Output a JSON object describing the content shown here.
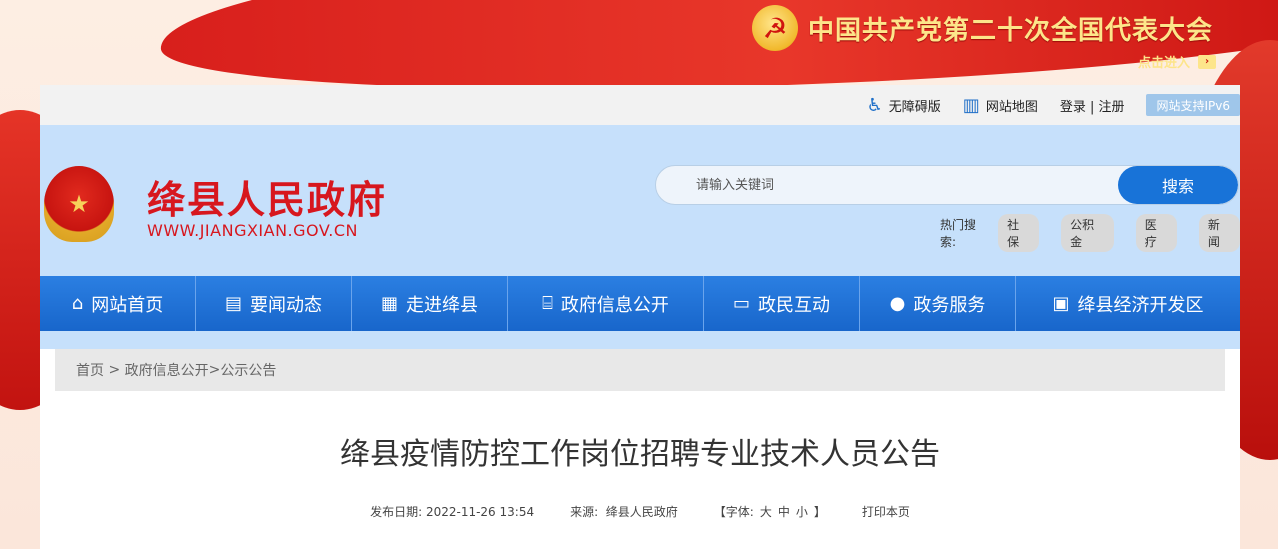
{
  "banner": {
    "congress_title": "中国共产党第二十次全国代表大会",
    "enter_label": "点击进入",
    "enter_arrow": "›",
    "emblem_glyph": "☭"
  },
  "topbar": {
    "accessibility_label": "无障碍版",
    "sitemap_label": "网站地图",
    "login_label": "登录 | 注册",
    "ipv6_label": "网站支持IPv6"
  },
  "header": {
    "site_name": "绛县人民政府",
    "site_url": "WWW.JIANGXIAN.GOV.CN",
    "emblem_glyph": "★",
    "search": {
      "placeholder": "请输入关键词",
      "button_label": "搜索"
    },
    "hot_label": "热门搜索:",
    "hot_tags": [
      "社保",
      "公积金",
      "医疗",
      "新闻"
    ]
  },
  "nav": {
    "items": [
      {
        "label": "网站首页",
        "icon": "home-icon",
        "glyph": "⌂"
      },
      {
        "label": "要闻动态",
        "icon": "news-icon",
        "glyph": "▤"
      },
      {
        "label": "走进绛县",
        "icon": "building-icon",
        "glyph": "▦"
      },
      {
        "label": "政府信息公开",
        "icon": "government-icon",
        "glyph": "⌸"
      },
      {
        "label": "政民互动",
        "icon": "chat-icon",
        "glyph": "▭"
      },
      {
        "label": "政务服务",
        "icon": "user-service-icon",
        "glyph": "●"
      },
      {
        "label": "绛县经济开发区",
        "icon": "map-icon",
        "glyph": "▣"
      }
    ]
  },
  "breadcrumb": {
    "items": [
      "首页",
      " > ",
      "政府信息公开",
      ">",
      "公示公告"
    ]
  },
  "article": {
    "title": "绛县疫情防控工作岗位招聘专业技术人员公告",
    "publish_label": "发布日期:",
    "publish_date": "2022-11-26 13:54",
    "source_label": "来源:",
    "source_value": "绛县人民政府",
    "font_label": "【字体:",
    "font_large": "大",
    "font_medium": "中",
    "font_small": "小",
    "font_close": "】",
    "print_label": "打印本页"
  },
  "colors": {
    "brand_red": "#d7171e",
    "nav_blue": "#1f72d8",
    "header_bg": "#c6e0fb"
  }
}
